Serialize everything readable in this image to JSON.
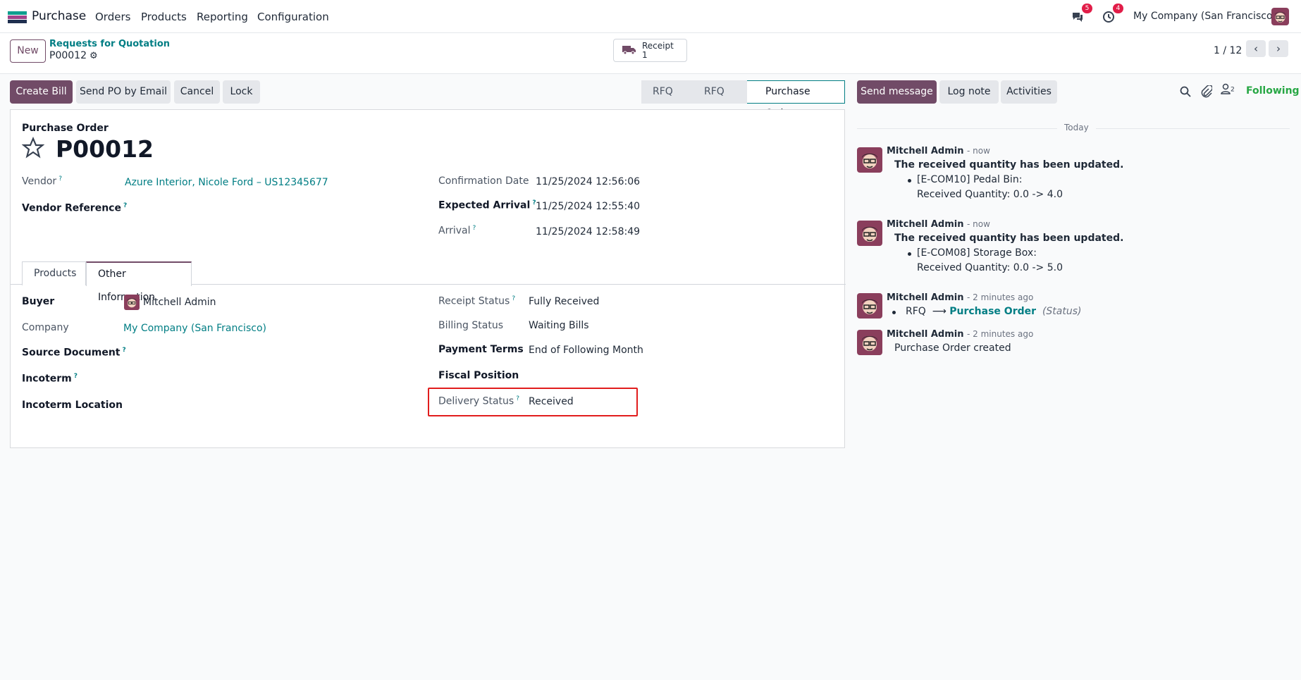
{
  "topbar": {
    "app_name": "Purchase",
    "menu": [
      "Orders",
      "Products",
      "Reporting",
      "Configuration"
    ],
    "chat_count": "5",
    "activity_count": "4",
    "company": "My Company (San Francisco)"
  },
  "control": {
    "new_label": "New",
    "breadcrumb_parent": "Requests for Quotation",
    "breadcrumb_current": "P00012",
    "smart_button": {
      "label": "Receipt",
      "count": "1"
    },
    "pager": "1 / 12"
  },
  "actions": {
    "create_bill": "Create Bill",
    "send_po": "Send PO by Email",
    "cancel": "Cancel",
    "lock": "Lock"
  },
  "status_stages": [
    "RFQ",
    "RFQ Sent",
    "Purchase Order"
  ],
  "form": {
    "doc_type": "Purchase Order",
    "name": "P00012",
    "vendor_label": "Vendor",
    "vendor_value": "Azure Interior, Nicole Ford – US12345677",
    "vendor_ref_label": "Vendor Reference",
    "confirmation_label": "Confirmation Date",
    "confirmation_value": "11/25/2024 12:56:06",
    "expected_label": "Expected Arrival",
    "expected_value": "11/25/2024 12:55:40",
    "arrival_label": "Arrival",
    "arrival_value": "11/25/2024 12:58:49",
    "tabs": [
      "Products",
      "Other Information"
    ],
    "buyer_label": "Buyer",
    "buyer_value": "Mitchell Admin",
    "company_label": "Company",
    "company_value": "My Company (San Francisco)",
    "source_label": "Source Document",
    "incoterm_label": "Incoterm",
    "incoterm_location_label": "Incoterm Location",
    "receipt_status_label": "Receipt Status",
    "receipt_status_value": "Fully Received",
    "billing_status_label": "Billing Status",
    "billing_status_value": "Waiting Bills",
    "payment_terms_label": "Payment Terms",
    "payment_terms_value": "End of Following Month",
    "fiscal_label": "Fiscal Position",
    "delivery_label": "Delivery Status",
    "delivery_value": "Received"
  },
  "chatter": {
    "send_message": "Send message",
    "log_note": "Log note",
    "activities": "Activities",
    "followers_count": "2",
    "following": "Following",
    "today": "Today",
    "messages": [
      {
        "author": "Mitchell Admin",
        "time": "- now",
        "title": "The received quantity has been updated.",
        "item": "[E-COM10] Pedal Bin:",
        "detail": "Received Quantity: 0.0 -> 4.0"
      },
      {
        "author": "Mitchell Admin",
        "time": "- now",
        "title": "The received quantity has been updated.",
        "item": "[E-COM08] Storage Box:",
        "detail": "Received Quantity: 0.0 -> 5.0"
      },
      {
        "author": "Mitchell Admin",
        "time": "- 2 minutes ago",
        "from": "RFQ",
        "arrow": "⟶",
        "to": "Purchase Order",
        "field": "(Status)"
      },
      {
        "author": "Mitchell Admin",
        "time": "- 2 minutes ago",
        "body": "Purchase Order created"
      }
    ]
  }
}
